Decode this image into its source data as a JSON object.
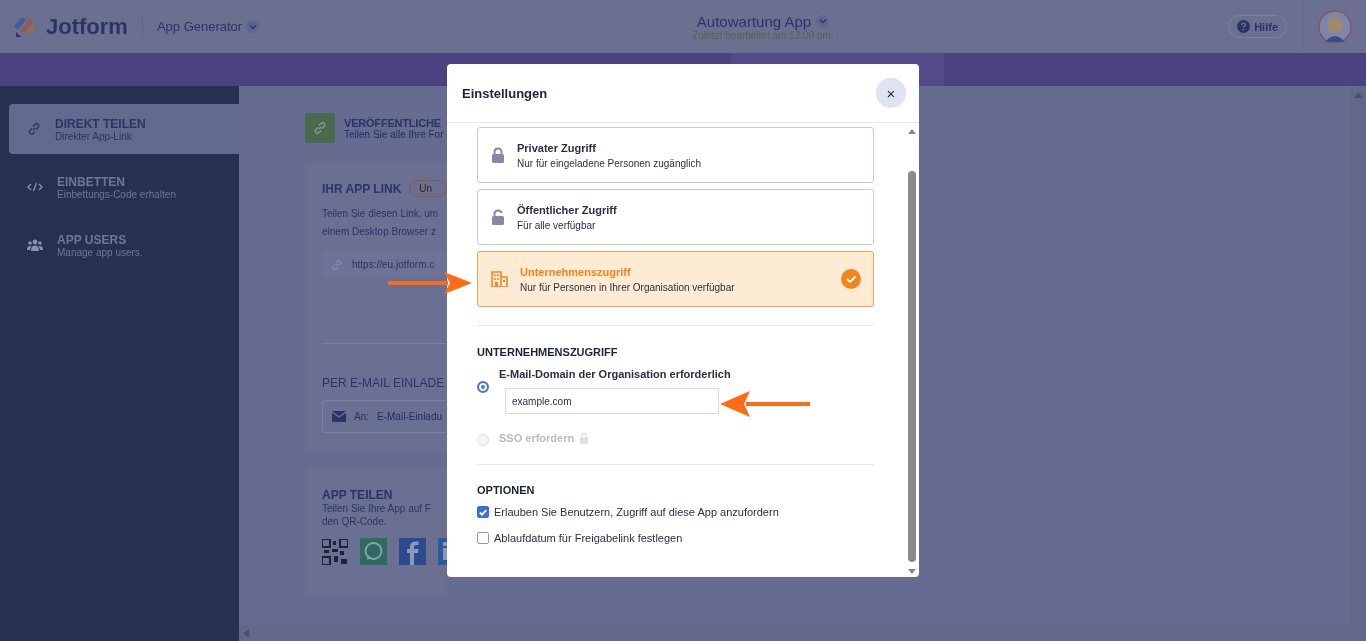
{
  "header": {
    "logo": "Jotform",
    "product": "App Generator",
    "app_title": "Autowartung App",
    "last_edited": "Zuletzt bearbeitet am 12:00 pm.",
    "help": "Hilfe"
  },
  "sidebar": {
    "items": [
      {
        "title": "DIREKT TEILEN",
        "subtitle": "Direkter App-Link",
        "selected": true
      },
      {
        "title": "EINBETTEN",
        "subtitle": "Einbettungs-Code erhalten",
        "selected": false
      },
      {
        "title": "APP USERS",
        "subtitle": "Manage app users.",
        "selected": false
      }
    ]
  },
  "content": {
    "publish": {
      "title": "VERÖFFENTLICHE",
      "subtitle": "Teilen Sie alle Ihre For"
    },
    "app_link": {
      "title": "IHR APP LINK",
      "badge": "Un",
      "description": [
        "Teilen Sie diesen Link, um",
        "einem Desktop Browser z"
      ],
      "url": "https://eu.jotform.c"
    },
    "email": {
      "title": "PER E-MAIL EINLADE",
      "to_label": "An:",
      "placeholder": "E-Mail-Einladu"
    },
    "share": {
      "title": "APP TEILEN",
      "description": [
        "Teilen Sie Ihre App auf F",
        "den QR-Code."
      ]
    }
  },
  "modal": {
    "title": "Einstellungen",
    "close": "×",
    "access_options": [
      {
        "title": "Privater Zugriff",
        "subtitle": "Nur für eingeladene Personen zugänglich",
        "selected": false
      },
      {
        "title": "Öffentlicher Zugriff",
        "subtitle": "Für alle verfügbar",
        "selected": false
      },
      {
        "title": "Unternehmenszugriff",
        "subtitle": "Nur für Personen in Ihrer Organisation verfügbar",
        "selected": true
      }
    ],
    "section_title": "UNTERNEHMENSZUGRIFF",
    "radios": [
      {
        "label": "E-Mail-Domain der Organisation erforderlich",
        "selected": true,
        "disabled": false,
        "value": "example.com"
      },
      {
        "label": "SSO erfordern",
        "selected": false,
        "disabled": true
      }
    ],
    "options_title": "OPTIONEN",
    "checks": [
      {
        "label": "Erlauben Sie Benutzern, Zugriff auf diese App anzufordern",
        "checked": true
      },
      {
        "label": "Ablaufdatum für Freigabelink festlegen",
        "checked": false
      }
    ]
  }
}
